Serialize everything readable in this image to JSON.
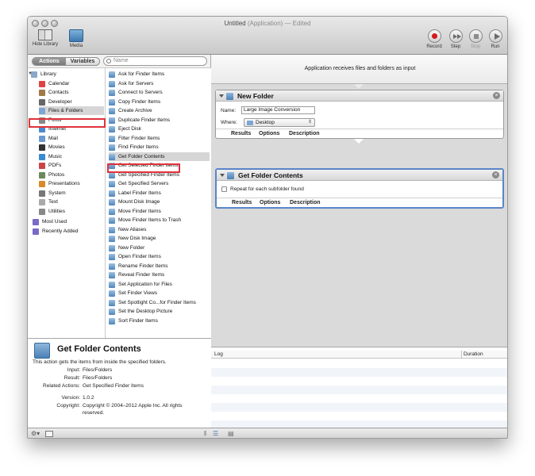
{
  "window": {
    "title_main": "Untitled",
    "title_kind": "(Application)",
    "title_sep": "—",
    "title_status": "Edited"
  },
  "toolbar": {
    "hide_library": "Hide Library",
    "media": "Media",
    "record": "Record",
    "step": "Step",
    "stop": "Stop",
    "run": "Run"
  },
  "library": {
    "tab_actions": "Actions",
    "tab_variables": "Variables",
    "search_placeholder": "Name",
    "categories": [
      {
        "label": "Library",
        "icon": "library-icon",
        "color": "#8aa8c8"
      },
      {
        "label": "Calendar",
        "icon": "calendar-icon",
        "color": "#d44"
      },
      {
        "label": "Contacts",
        "icon": "contacts-icon",
        "color": "#a07a4a"
      },
      {
        "label": "Developer",
        "icon": "developer-icon",
        "color": "#666"
      },
      {
        "label": "Files & Folders",
        "icon": "files-folders-icon",
        "color": "#7ea6d3"
      },
      {
        "label": "Fonts",
        "icon": "fonts-icon",
        "color": "#888"
      },
      {
        "label": "Internet",
        "icon": "internet-icon",
        "color": "#4a8ad0"
      },
      {
        "label": "Mail",
        "icon": "mail-icon",
        "color": "#6a9ad0"
      },
      {
        "label": "Movies",
        "icon": "movies-icon",
        "color": "#333"
      },
      {
        "label": "Music",
        "icon": "music-icon",
        "color": "#3a8ad0"
      },
      {
        "label": "PDFs",
        "icon": "pdfs-icon",
        "color": "#c44"
      },
      {
        "label": "Photos",
        "icon": "photos-icon",
        "color": "#6a8a5a"
      },
      {
        "label": "Presentations",
        "icon": "presentations-icon",
        "color": "#d88a2a"
      },
      {
        "label": "System",
        "icon": "system-icon",
        "color": "#777"
      },
      {
        "label": "Text",
        "icon": "text-icon",
        "color": "#aaa"
      },
      {
        "label": "Utilities",
        "icon": "utilities-icon",
        "color": "#888"
      },
      {
        "label": "Most Used",
        "icon": "most-used-icon",
        "color": "#7a6ac8"
      },
      {
        "label": "Recently Added",
        "icon": "recently-added-icon",
        "color": "#7a6ac8"
      }
    ],
    "actions": [
      "Ask for Finder Items",
      "Ask for Servers",
      "Connect to Servers",
      "Copy Finder Items",
      "Create Archive",
      "Duplicate Finder Items",
      "Eject Disk",
      "Filter Finder Items",
      "Find Finder Items",
      "Get Folder Contents",
      "Get Selected Finder Items",
      "Get Specified Finder Items",
      "Get Specified Servers",
      "Label Finder Items",
      "Mount Disk Image",
      "Move Finder Items",
      "Move Finder Items to Trash",
      "New Aliases",
      "New Disk Image",
      "New Folder",
      "Open Finder Items",
      "Rename Finder Items",
      "Reveal Finder Items",
      "Set Application for Files",
      "Set Finder Views",
      "Set Spotlight Co...for Finder Items",
      "Set the Desktop Picture",
      "Sort Finder Items"
    ]
  },
  "description": {
    "title": "Get Folder Contents",
    "text": "This action gets the items from inside the specified folders.",
    "input_label": "Input:",
    "input_value": "Files/Folders",
    "result_label": "Result:",
    "result_value": "Files/Folders",
    "related_label": "Related Actions:",
    "related_value": "Get Specified Finder Items",
    "version_label": "Version:",
    "version_value": "1.0.2",
    "copyright_label": "Copyright:",
    "copyright_line1": "Copyright © 2004–2012 Apple Inc.  All rights",
    "copyright_line2": "reserved."
  },
  "workflow": {
    "banner": "Application receives files and folders as input",
    "new_folder": {
      "title": "New Folder",
      "name_label": "Name:",
      "name_value": "Large Image Conversion",
      "where_label": "Where:",
      "where_value": "Desktop",
      "tabs": [
        "Results",
        "Options",
        "Description"
      ]
    },
    "get_folder": {
      "title": "Get Folder Contents",
      "checkbox_label": "Repeat for each subfolder found",
      "tabs": [
        "Results",
        "Options",
        "Description"
      ]
    }
  },
  "log": {
    "col_log": "Log",
    "col_duration": "Duration"
  },
  "colors": {
    "selection_box": "#e0333a",
    "record": "#d4181c",
    "selected_card": "#5a86c8"
  }
}
